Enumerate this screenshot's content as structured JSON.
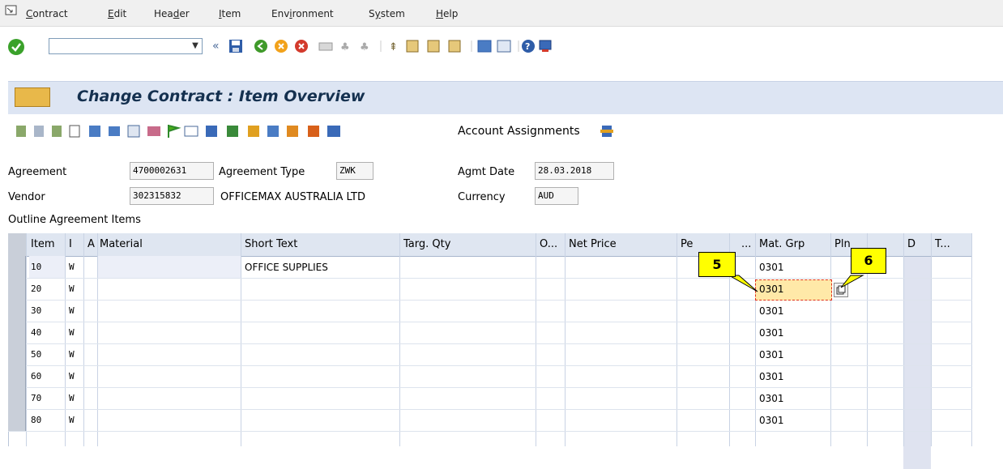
{
  "menu": {
    "items": [
      {
        "pre": "",
        "ul": "C",
        "post": "ontract"
      },
      {
        "pre": "",
        "ul": "E",
        "post": "dit"
      },
      {
        "pre": "Hea",
        "ul": "d",
        "post": "er"
      },
      {
        "pre": "",
        "ul": "I",
        "post": "tem"
      },
      {
        "pre": "Env",
        "ul": "i",
        "post": "ronment"
      },
      {
        "pre": "S",
        "ul": "y",
        "post": "stem"
      },
      {
        "pre": "",
        "ul": "H",
        "post": "elp"
      }
    ]
  },
  "toolbar": {
    "command_value": "",
    "back_chevrons": "«"
  },
  "title": "Change Contract : Item Overview",
  "app_toolbar": {
    "account_assignments": "Account Assignments"
  },
  "header": {
    "agreement_label": "Agreement",
    "agreement_value": "4700002631",
    "agreement_type_label": "Agreement Type",
    "agreement_type_value": "ZWK",
    "agmt_date_label": "Agmt Date",
    "agmt_date_value": "28.03.2018",
    "vendor_label": "Vendor",
    "vendor_value": "302315832",
    "vendor_name": "OFFICEMAX AUSTRALIA LTD",
    "currency_label": "Currency",
    "currency_value": "AUD",
    "section_title": "Outline Agreement Items"
  },
  "table": {
    "columns": [
      "Item",
      "I",
      "A",
      "Material",
      "Short Text",
      "Targ. Qty",
      "O...",
      "Net Price",
      "Pe",
      "...",
      "Mat. Grp",
      "Pln",
      "",
      "D",
      "T..."
    ],
    "rows": [
      {
        "item": "10",
        "i": "W",
        "short_text": "OFFICE SUPPLIES",
        "mat_grp": "0301"
      },
      {
        "item": "20",
        "i": "W",
        "short_text": "",
        "mat_grp": "0301"
      },
      {
        "item": "30",
        "i": "W",
        "short_text": "",
        "mat_grp": "0301"
      },
      {
        "item": "40",
        "i": "W",
        "short_text": "",
        "mat_grp": "0301"
      },
      {
        "item": "50",
        "i": "W",
        "short_text": "",
        "mat_grp": "0301"
      },
      {
        "item": "60",
        "i": "W",
        "short_text": "",
        "mat_grp": "0301"
      },
      {
        "item": "70",
        "i": "W",
        "short_text": "",
        "mat_grp": "0301"
      },
      {
        "item": "80",
        "i": "W",
        "short_text": "",
        "mat_grp": "0301"
      }
    ]
  },
  "callouts": {
    "five": "5",
    "six": "6"
  },
  "colors": {
    "title_bg": "#dde5f3",
    "grid_header": "#dfe6f1",
    "callout": "#ffff00",
    "active_cell": "#ffe9a8",
    "active_border": "#e0301e"
  }
}
